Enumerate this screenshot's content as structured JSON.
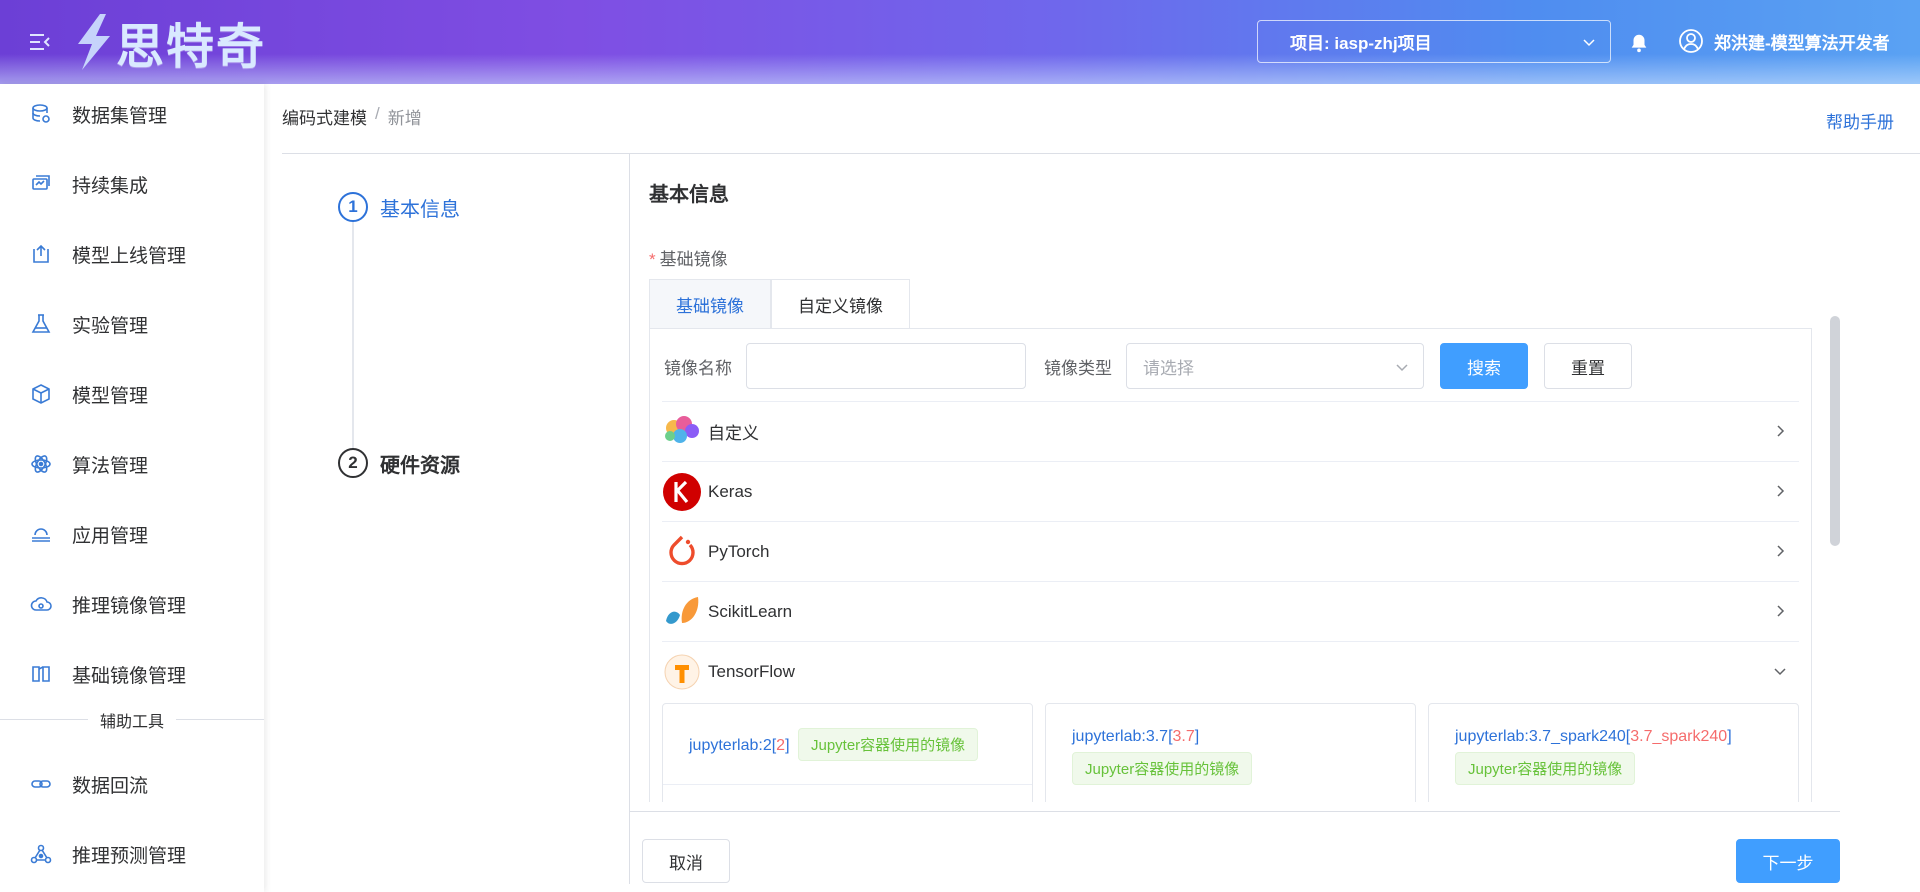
{
  "header": {
    "logo_text": "思特奇",
    "project": "项目: iasp-zhj项目",
    "user": "郑洪建-模型算法开发者"
  },
  "sidebar": {
    "items": [
      {
        "label": "数据集管理",
        "icon": "database-icon"
      },
      {
        "label": "持续集成",
        "icon": "integration-icon"
      },
      {
        "label": "模型上线管理",
        "icon": "upload-icon"
      },
      {
        "label": "实验管理",
        "icon": "flask-icon"
      },
      {
        "label": "模型管理",
        "icon": "cube-icon"
      },
      {
        "label": "算法管理",
        "icon": "atom-icon"
      },
      {
        "label": "应用管理",
        "icon": "cloud-stack-icon"
      },
      {
        "label": "推理镜像管理",
        "icon": "cloud-icon"
      },
      {
        "label": "基础镜像管理",
        "icon": "book-icon"
      }
    ],
    "group_title": "辅助工具",
    "tool_items": [
      {
        "label": "数据回流",
        "icon": "link-icon"
      },
      {
        "label": "推理预测管理",
        "icon": "network-icon"
      }
    ]
  },
  "breadcrumb": {
    "parent": "编码式建模",
    "separator": "/",
    "current": "新增"
  },
  "help_link": "帮助手册",
  "steps": [
    {
      "num": "1",
      "label": "基本信息",
      "state": "active"
    },
    {
      "num": "2",
      "label": "硬件资源",
      "state": "pending"
    }
  ],
  "form": {
    "section_title": "基本信息",
    "required_mark": "*",
    "field_label": "基础镜像",
    "tabs": [
      "基础镜像",
      "自定义镜像"
    ],
    "search": {
      "name_label": "镜像名称",
      "name_value": "",
      "type_label": "镜像类型",
      "type_placeholder": "请选择",
      "search_btn": "搜索",
      "reset_btn": "重置"
    },
    "frameworks": [
      {
        "name": "自定义",
        "expanded": false
      },
      {
        "name": "Keras",
        "expanded": false
      },
      {
        "name": "PyTorch",
        "expanded": false
      },
      {
        "name": "ScikitLearn",
        "expanded": false
      },
      {
        "name": "TensorFlow",
        "expanded": true
      }
    ],
    "cards": [
      {
        "name": "jupyterlab:2",
        "bracket_open": "[",
        "version": "2",
        "bracket_close": "]",
        "badge": "Jupyter容器使用的镜像"
      },
      {
        "name": "jupyterlab:3.7",
        "bracket_open": "[",
        "version": "3.7",
        "bracket_close": "]",
        "badge": "Jupyter容器使用的镜像"
      },
      {
        "name": "jupyterlab:3.7_spark240",
        "bracket_open": "[",
        "version": "3.7_spark240",
        "bracket_close": "]",
        "badge": "Jupyter容器使用的镜像"
      }
    ]
  },
  "footer": {
    "cancel": "取消",
    "next": "下一步"
  },
  "colors": {
    "primary": "#409eff",
    "link": "#2d72d9",
    "danger": "#f56c6c",
    "success": "#67c23a"
  }
}
